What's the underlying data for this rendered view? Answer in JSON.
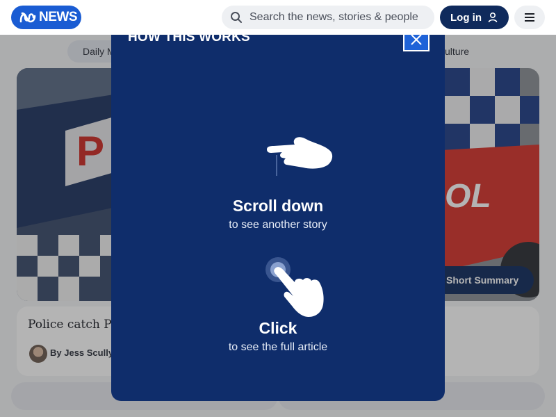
{
  "header": {
    "logo_text": "NEWS",
    "search_placeholder": "Search the news, stories & people",
    "login_label": "Log in"
  },
  "background": {
    "chips": [
      "Daily M",
      "ulture"
    ],
    "summary_button": "Short Summary",
    "article_title": "Police catch P-",
    "byline": "By Jess Scully"
  },
  "modal": {
    "title": "HOW THIS WORKS",
    "steps": [
      {
        "title": "Scroll down",
        "subtitle": "to see another story"
      },
      {
        "title": "Click",
        "subtitle": "to see the full article"
      }
    ]
  },
  "colors": {
    "brand": "#1a5cd3",
    "modal_bg": "#0f2d6b",
    "login_bg": "#0f2a5c"
  },
  "icons": [
    "abc-logo-icon",
    "search-icon",
    "user-icon",
    "hamburger-menu-icon",
    "close-icon",
    "pointing-hand-icon",
    "tap-hand-icon"
  ]
}
